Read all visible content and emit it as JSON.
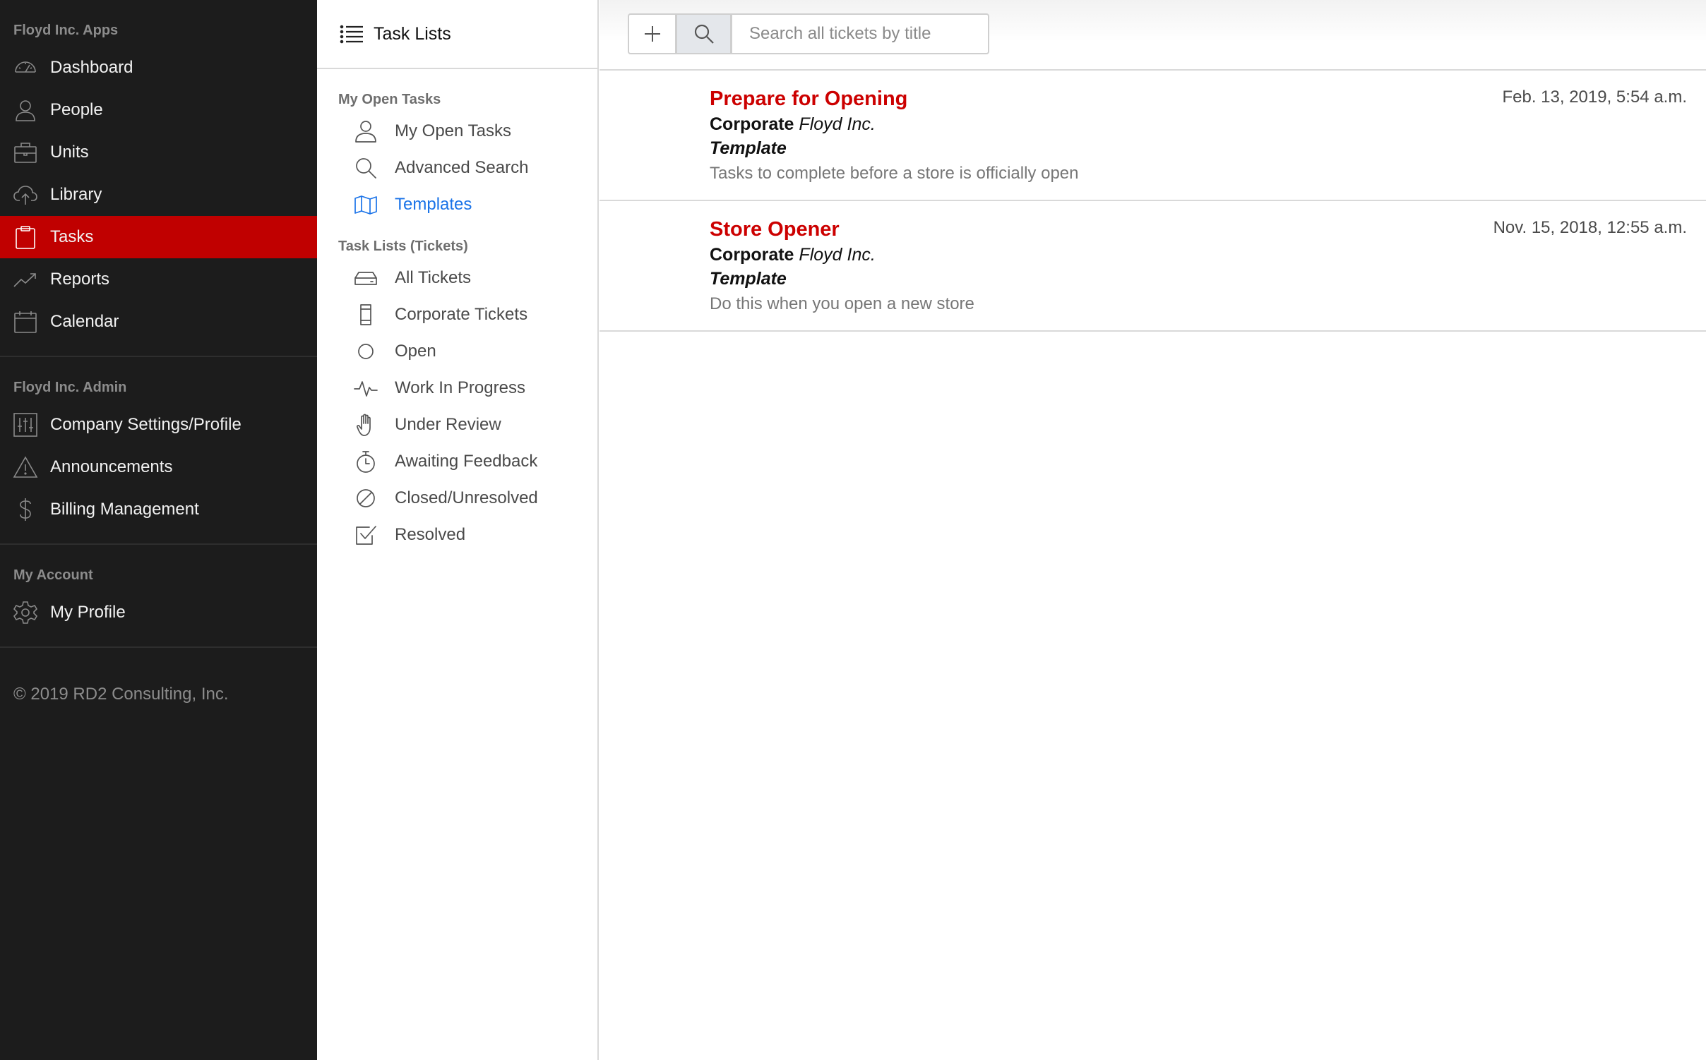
{
  "sidebar": {
    "apps_heading": "Floyd Inc. Apps",
    "apps": [
      {
        "label": "Dashboard",
        "icon": "dashboard-icon"
      },
      {
        "label": "People",
        "icon": "person-icon"
      },
      {
        "label": "Units",
        "icon": "briefcase-icon"
      },
      {
        "label": "Library",
        "icon": "cloud-upload-icon"
      },
      {
        "label": "Tasks",
        "icon": "clipboard-icon",
        "active": true
      },
      {
        "label": "Reports",
        "icon": "trend-icon"
      },
      {
        "label": "Calendar",
        "icon": "calendar-icon"
      }
    ],
    "admin_heading": "Floyd Inc. Admin",
    "admin": [
      {
        "label": "Company Settings/Profile",
        "icon": "sliders-icon"
      },
      {
        "label": "Announcements",
        "icon": "warning-icon"
      },
      {
        "label": "Billing Management",
        "icon": "dollar-icon"
      }
    ],
    "account_heading": "My Account",
    "account": [
      {
        "label": "My Profile",
        "icon": "gear-icon"
      }
    ],
    "copyright": "© 2019 RD2 Consulting, Inc."
  },
  "middle": {
    "header_title": "Task Lists",
    "open_tasks_heading": "My Open Tasks",
    "open_tasks": [
      {
        "label": "My Open Tasks",
        "icon": "person-icon"
      },
      {
        "label": "Advanced Search",
        "icon": "search-icon"
      },
      {
        "label": "Templates",
        "icon": "map-icon",
        "active": true
      }
    ],
    "tickets_heading": "Task Lists (Tickets)",
    "tickets": [
      {
        "label": "All Tickets",
        "icon": "inbox-icon"
      },
      {
        "label": "Corporate Tickets",
        "icon": "bookmark-icon"
      },
      {
        "label": "Open",
        "icon": "circle-icon"
      },
      {
        "label": "Work In Progress",
        "icon": "activity-icon"
      },
      {
        "label": "Under Review",
        "icon": "hand-icon"
      },
      {
        "label": "Awaiting Feedback",
        "icon": "stopwatch-icon"
      },
      {
        "label": "Closed/Unresolved",
        "icon": "slash-circle-icon"
      },
      {
        "label": "Resolved",
        "icon": "checkbox-icon"
      }
    ]
  },
  "toolbar": {
    "search_placeholder": "Search all tickets by title"
  },
  "tickets": [
    {
      "title": "Prepare for Opening",
      "date": "Feb. 13, 2019, 5:54 a.m.",
      "org_label": "Corporate",
      "org_name": "Floyd Inc.",
      "type": "Template",
      "description": "Tasks to complete before a store is officially open"
    },
    {
      "title": "Store Opener",
      "date": "Nov. 15, 2018, 12:55 a.m.",
      "org_label": "Corporate",
      "org_name": "Floyd Inc.",
      "type": "Template",
      "description": "Do this when you open a new store"
    }
  ],
  "colors": {
    "sidebar_bg": "#1c1c1c",
    "accent_red": "#c00000",
    "ticket_title_red": "#cc0000",
    "link_blue": "#1a73e8"
  }
}
